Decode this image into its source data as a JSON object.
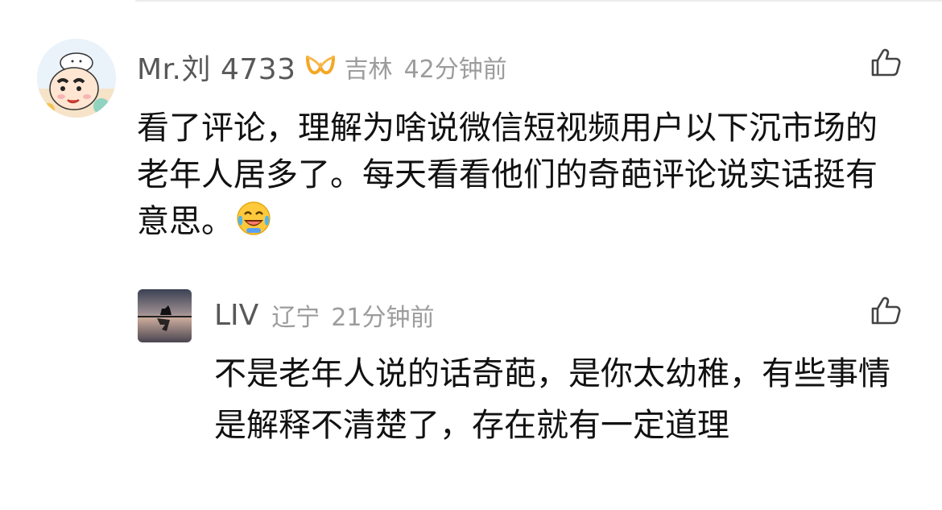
{
  "comment": {
    "username": "Mr.刘 4733",
    "badge_icon": "vip-badge-icon",
    "location": "吉林",
    "time": "42分钟前",
    "text": "看了评论，理解为啥说微信短视频用户以下沉市场的老年人居多了。每天看看他们的奇葩评论说实话挺有意思。",
    "emoji": "laughing-crying-emoji",
    "like_icon": "thumbs-up-icon"
  },
  "reply": {
    "username": "LIV",
    "location": "辽宁",
    "time": "21分钟前",
    "text": "不是老年人说的话奇葩，是你太幼稚，有些事情是解释不清楚了，存在就有一定道理",
    "like_icon": "thumbs-up-icon"
  },
  "colors": {
    "name_gray": "#585858",
    "meta_gray": "#9c9c9c",
    "body_text": "#111111",
    "badge_orange": "#f5a623"
  }
}
